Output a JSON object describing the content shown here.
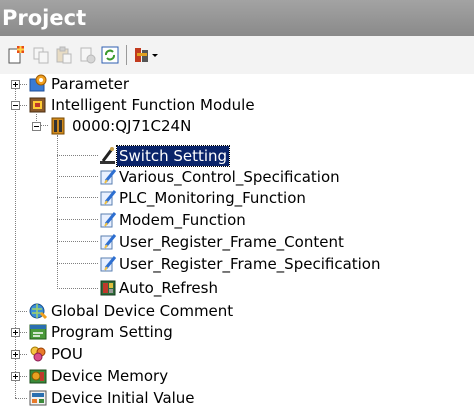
{
  "window": {
    "title": "Project"
  },
  "toolbar": {
    "buttons": [
      {
        "icon": "new-data-icon"
      },
      {
        "icon": "copy-icon"
      },
      {
        "icon": "paste-icon"
      },
      {
        "icon": "delete-icon"
      },
      {
        "icon": "refresh-icon"
      },
      {
        "icon": "settings-dropdown-icon"
      }
    ]
  },
  "tree": {
    "items": [
      {
        "label": "Parameter",
        "icon": "parameter-icon",
        "expander": "plus"
      },
      {
        "label": "Intelligent Function Module",
        "icon": "module-icon",
        "expander": "minus"
      },
      {
        "label": "0000:QJ71C24N",
        "icon": "module-unit-icon",
        "expander": "minus"
      },
      {
        "label": "Switch Setting",
        "icon": "switch-setting-icon",
        "selected": true
      },
      {
        "label": "Various_Control_Specification",
        "icon": "document-edit-icon"
      },
      {
        "label": "PLC_Monitoring_Function",
        "icon": "document-edit-icon"
      },
      {
        "label": "Modem_Function",
        "icon": "document-edit-icon"
      },
      {
        "label": "User_Register_Frame_Content",
        "icon": "document-edit-icon"
      },
      {
        "label": "User_Register_Frame_Specification",
        "icon": "document-edit-icon"
      },
      {
        "label": "Auto_Refresh",
        "icon": "auto-refresh-icon"
      },
      {
        "label": "Global Device Comment",
        "icon": "global-comment-icon"
      },
      {
        "label": "Program Setting",
        "icon": "program-setting-icon",
        "expander": "plus"
      },
      {
        "label": "POU",
        "icon": "pou-icon",
        "expander": "plus"
      },
      {
        "label": "Device Memory",
        "icon": "device-memory-icon",
        "expander": "plus"
      },
      {
        "label": "Device Initial Value",
        "icon": "device-initial-value-icon"
      }
    ]
  }
}
